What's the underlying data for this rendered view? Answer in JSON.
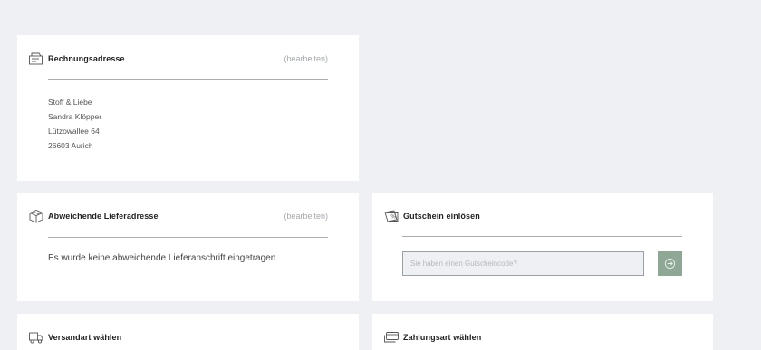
{
  "billing": {
    "title": "Rechnungsadresse",
    "edit_label": "(bearbeiten)",
    "icon": "invoice-icon",
    "address_lines": [
      "Stoff & Liebe",
      "Sandra Klöpper",
      "Lützowallee 64",
      "26603 Aurich"
    ]
  },
  "delivery": {
    "title": "Abweichende Lieferadresse",
    "edit_label": "(bearbeiten)",
    "icon": "package-icon",
    "empty_message": "Es wurde keine abweichende Lieferanschrift eingetragen."
  },
  "voucher": {
    "title": "Gutschein einlösen",
    "icon": "voucher-icon",
    "placeholder": "Sie haben einen Gutscheincode?",
    "value": ""
  },
  "shipping": {
    "title": "Versandart wählen",
    "icon": "truck-icon"
  },
  "payment": {
    "title": "Zahlungsart wählen",
    "icon": "card-icon"
  },
  "colors": {
    "background": "#eef0f4",
    "card": "#ffffff",
    "accent_button": "#8fa896",
    "muted_text": "#a4a8ad"
  }
}
